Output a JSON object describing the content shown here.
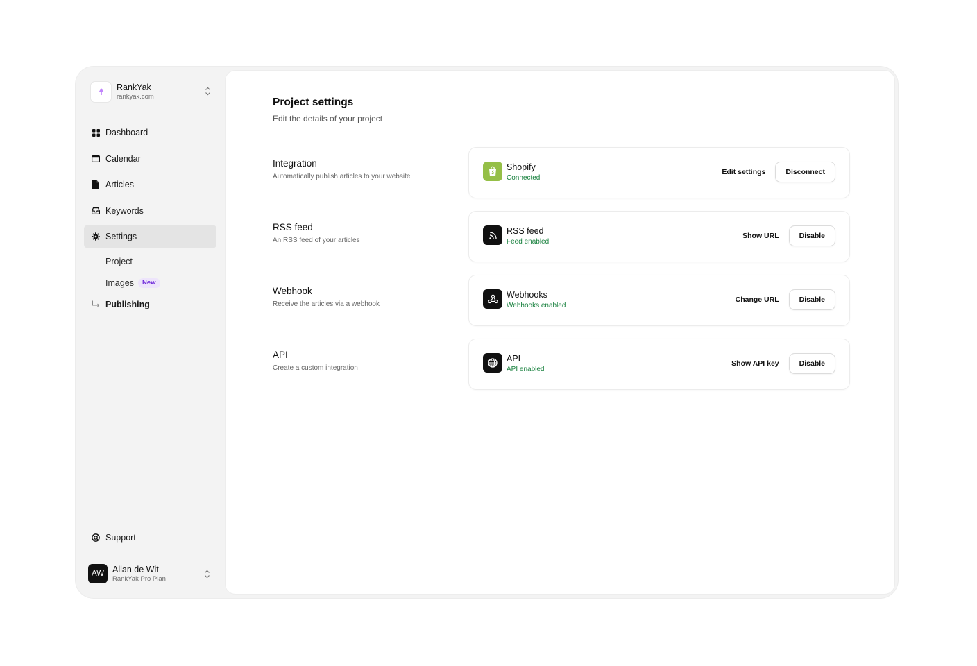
{
  "project": {
    "name": "RankYak",
    "domain": "rankyak.com"
  },
  "nav": {
    "dashboard": "Dashboard",
    "calendar": "Calendar",
    "articles": "Articles",
    "keywords": "Keywords",
    "settings": "Settings",
    "sub_project": "Project",
    "sub_images": "Images",
    "sub_images_badge": "New",
    "publishing": "Publishing",
    "support": "Support"
  },
  "user": {
    "initials": "AW",
    "name": "Allan de Wit",
    "plan": "RankYak Pro Plan"
  },
  "page": {
    "title": "Project settings",
    "subtitle": "Edit the details of your project"
  },
  "sections": [
    {
      "title": "Integration",
      "description": "Automatically publish articles to your website",
      "card_name": "Shopify",
      "card_status": "Connected",
      "icon": "shopify-icon",
      "action_link": "Edit settings",
      "action_button": "Disconnect"
    },
    {
      "title": "RSS feed",
      "description": "An RSS feed of your articles",
      "card_name": "RSS feed",
      "card_status": "Feed enabled",
      "icon": "rss-icon",
      "action_link": "Show URL",
      "action_button": "Disable"
    },
    {
      "title": "Webhook",
      "description": "Receive the articles via a webhook",
      "card_name": "Webhooks",
      "card_status": "Webhooks enabled",
      "icon": "webhook-icon",
      "action_link": "Change URL",
      "action_button": "Disable"
    },
    {
      "title": "API",
      "description": "Create a custom integration",
      "card_name": "API",
      "card_status": "API enabled",
      "icon": "globe-icon",
      "action_link": "Show API key",
      "action_button": "Disable"
    }
  ],
  "colors": {
    "status_green": "#17803d",
    "shopify_green": "#95bf47",
    "badge_purple": "#6d28d9",
    "brand_purple": "#c084fc"
  }
}
